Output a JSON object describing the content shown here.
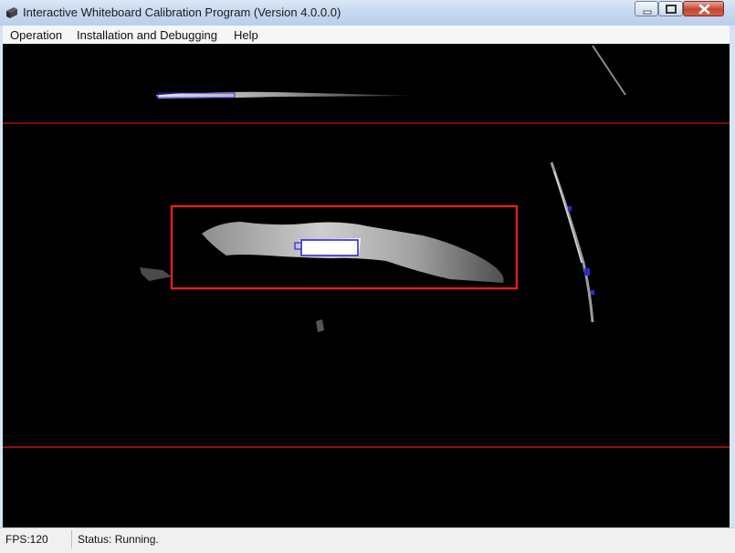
{
  "window": {
    "title": "Interactive Whiteboard Calibration Program (Version 4.0.0.0)",
    "icon": "app-icon",
    "controls": [
      "minimize-icon",
      "maximize-icon",
      "close-icon"
    ]
  },
  "menu": {
    "items": [
      {
        "label": "Operation"
      },
      {
        "label": "Installation and Debugging"
      },
      {
        "label": "Help"
      }
    ]
  },
  "viewport": {
    "description_colors": {
      "guide_lines": "#b01010",
      "selection_box": "#e02020",
      "marker": "#2a2ad8"
    }
  },
  "status": {
    "fps": "FPS:120",
    "text": "Status: Running."
  }
}
